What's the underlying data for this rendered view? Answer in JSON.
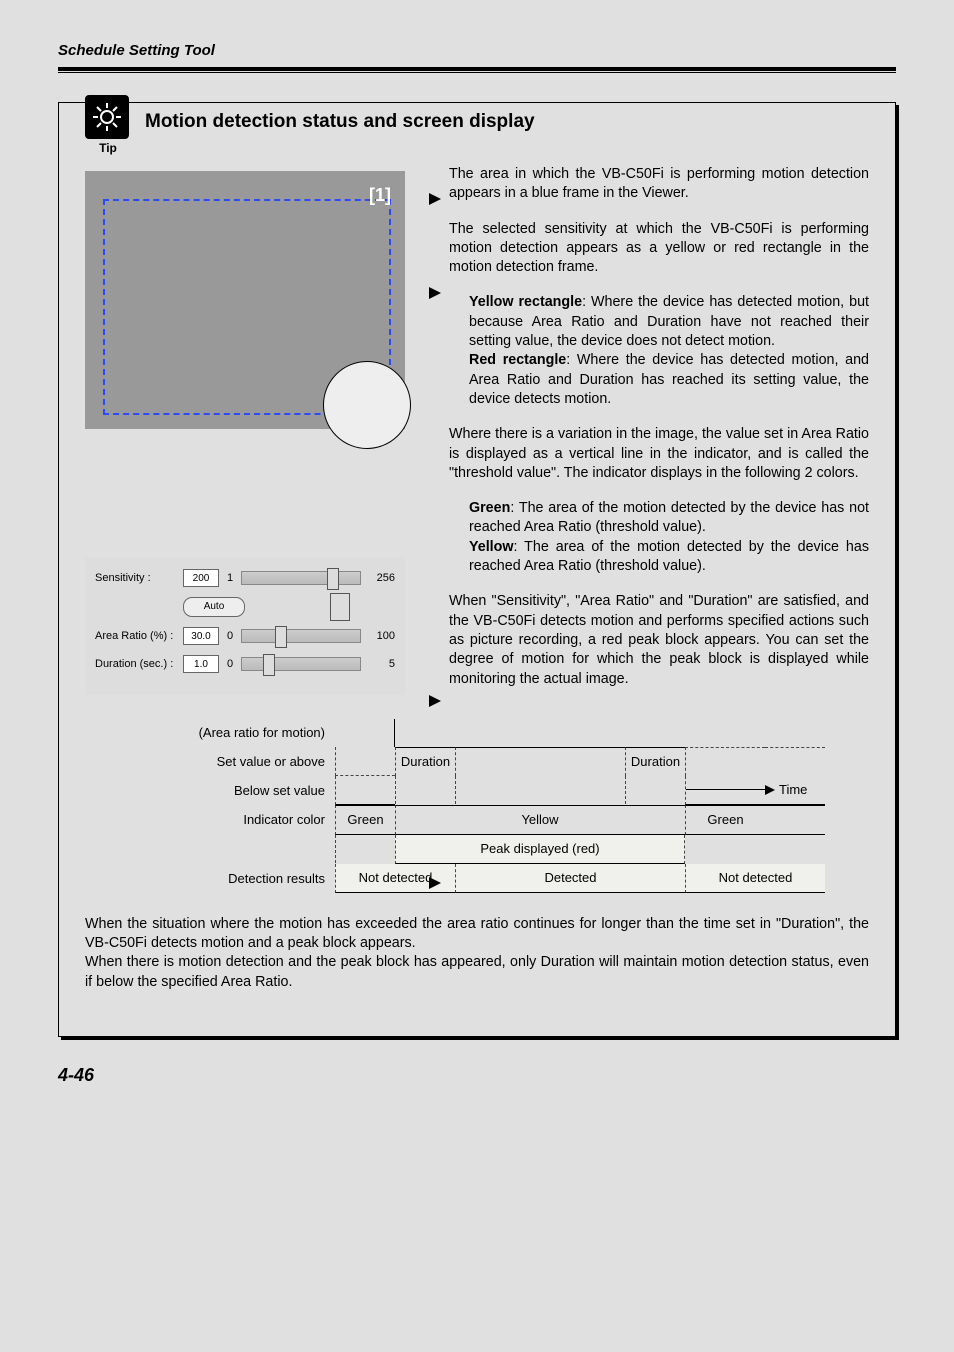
{
  "header": {
    "section_title": "Schedule Setting Tool"
  },
  "tip": {
    "icon_label": "Tip",
    "box_title": "Motion detection status and screen display"
  },
  "viewer_figure": {
    "frame_label": "[1]"
  },
  "paragraphs": {
    "p1": "The area in which the VB-C50Fi is performing motion detection appears in a blue frame in the Viewer.",
    "p2_intro": "The selected sensitivity at which the VB-C50Fi is performing motion detection appears as a yellow or red rectangle in the motion detection frame.",
    "p2_yellow_bold": "Yellow rectangle",
    "p2_yellow_rest": ": Where the device has detected motion, but because Area Ratio and Duration have not reached their setting value, the device does not detect motion.",
    "p2_red_bold": "Red rectangle",
    "p2_red_rest": ": Where the device has detected motion, and Area Ratio and Duration has reached its setting value, the device detects motion.",
    "p3_intro": "Where there is a variation in the image, the value set in Area Ratio is displayed as a vertical line in the indicator, and is called the \"threshold value\". The indicator displays in the following 2 colors.",
    "p3_green_bold": "Green",
    "p3_green_rest": ": The area of the motion detected by the device has not reached Area Ratio (threshold value).",
    "p3_yellow_bold": "Yellow",
    "p3_yellow_rest": ": The area of the motion detected by the device has reached Area Ratio (threshold value).",
    "p4": "When \"Sensitivity\", \"Area Ratio\" and \"Duration\" are satisfied, and the VB-C50Fi detects motion and performs specified actions such as picture recording, a red peak block appears. You can set the degree of motion for which the peak block is displayed while monitoring the actual image."
  },
  "settings": {
    "sensitivity_label": "Sensitivity :",
    "sensitivity_value": "200",
    "sensitivity_min": "1",
    "sensitivity_max": "256",
    "auto_btn": "Auto",
    "arearatio_label": "Area Ratio (%) :",
    "arearatio_value": "30.0",
    "arearatio_min": "0",
    "arearatio_max": "100",
    "duration_label": "Duration (sec.) :",
    "duration_value": "1.0",
    "duration_min": "0",
    "duration_max": "5"
  },
  "timeline": {
    "axis_label": "(Area ratio for motion)",
    "set_above": "Set value or above",
    "below": "Below set value",
    "duration": "Duration",
    "time": "Time",
    "indicator_label": "Indicator color",
    "indicator_vals": [
      "Green",
      "",
      "Yellow",
      "",
      "Green",
      ""
    ],
    "peak_label": "",
    "peak_vals": [
      "",
      "",
      "Peak displayed (red)",
      "",
      "",
      ""
    ],
    "det_label": "Detection results",
    "det_vals": [
      "Not detected",
      "Detected",
      "Not detected"
    ]
  },
  "footer_para": "When the situation where the motion has exceeded the area ratio continues for longer than the time set in \"Duration\", the VB-C50Fi detects motion and a peak block appears.\nWhen there is motion detection and the peak block has appeared, only Duration will maintain motion detection status, even if below the specified Area Ratio.",
  "page_number": "4-46"
}
